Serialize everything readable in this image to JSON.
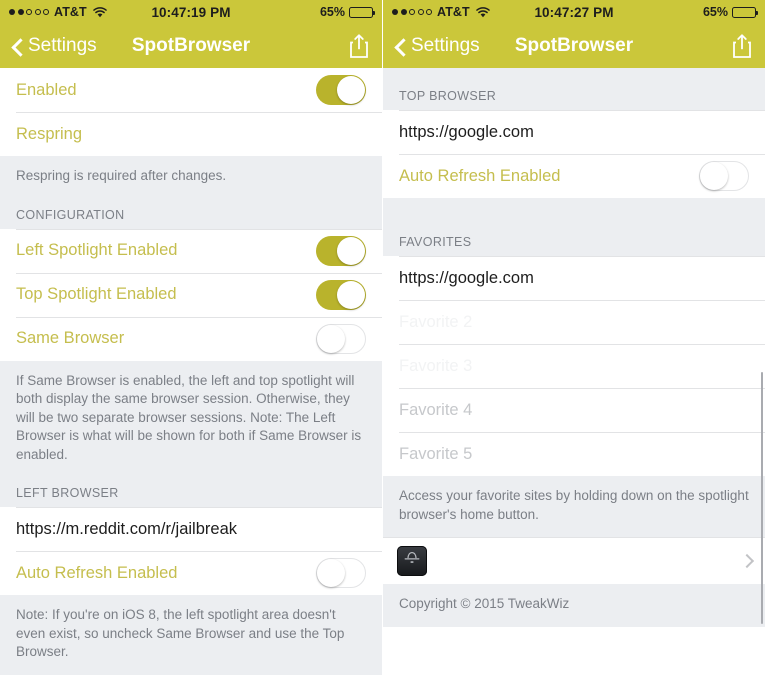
{
  "left": {
    "status": {
      "carrier": "AT&T",
      "signal_filled": 2,
      "signal_total": 5,
      "time": "10:47:19 PM",
      "battery_pct": "65%"
    },
    "nav": {
      "back_label": "Settings",
      "title": "SpotBrowser",
      "share_icon": "share-icon"
    },
    "rows": [
      {
        "type": "switch",
        "label": "Enabled",
        "on": true
      },
      {
        "type": "plain",
        "label": "Respring"
      },
      {
        "type": "footer",
        "text": "Respring is required after changes."
      },
      {
        "type": "header",
        "text": "CONFIGURATION"
      },
      {
        "type": "switch",
        "label": "Left Spotlight Enabled",
        "on": true
      },
      {
        "type": "switch",
        "label": "Top Spotlight Enabled",
        "on": true
      },
      {
        "type": "switch",
        "label": "Same Browser",
        "on": false
      },
      {
        "type": "footer",
        "text": "If Same Browser is enabled, the left and top spotlight will both display the same browser session. Otherwise, they will be two separate browser sessions. Note: The Left Browser is what will be shown for both if Same Browser is enabled."
      },
      {
        "type": "header",
        "text": "LEFT BROWSER"
      },
      {
        "type": "value",
        "value": "https://m.reddit.com/r/jailbreak"
      },
      {
        "type": "switch",
        "label": "Auto Refresh Enabled",
        "on": false
      },
      {
        "type": "footer",
        "text": "Note: If you're on iOS 8, the left spotlight area doesn't even exist, so uncheck Same Browser and use the Top Browser."
      }
    ]
  },
  "right": {
    "status": {
      "carrier": "AT&T",
      "signal_filled": 2,
      "signal_total": 5,
      "time": "10:47:27 PM",
      "battery_pct": "65%"
    },
    "nav": {
      "back_label": "Settings",
      "title": "SpotBrowser",
      "share_icon": "share-icon"
    },
    "rows": [
      {
        "type": "header",
        "text": "TOP BROWSER"
      },
      {
        "type": "value",
        "value": "https://google.com"
      },
      {
        "type": "switch",
        "label": "Auto Refresh Enabled",
        "on": false
      },
      {
        "type": "gap"
      },
      {
        "type": "header",
        "text": "FAVORITES"
      },
      {
        "type": "value",
        "value": "https://google.com"
      },
      {
        "type": "value_faint",
        "value": "Favorite 2"
      },
      {
        "type": "value_faint",
        "value": "Favorite 3"
      },
      {
        "type": "value_placeholder",
        "value": "Favorite 4"
      },
      {
        "type": "value_placeholder",
        "value": "Favorite 5"
      },
      {
        "type": "footer",
        "text": "Access your favorite sites by holding down on the spotlight browser's home button."
      },
      {
        "type": "app",
        "icon": "bowler-hat-app-icon",
        "disclosure": "chevron-right-icon"
      },
      {
        "type": "footer",
        "text": "Copyright © 2015 TweakWiz"
      }
    ]
  },
  "colors": {
    "navbar": "#cbc73a",
    "switch_on": "#b9b32c",
    "label": "#c5be4e",
    "table_bg": "#eceef1"
  }
}
